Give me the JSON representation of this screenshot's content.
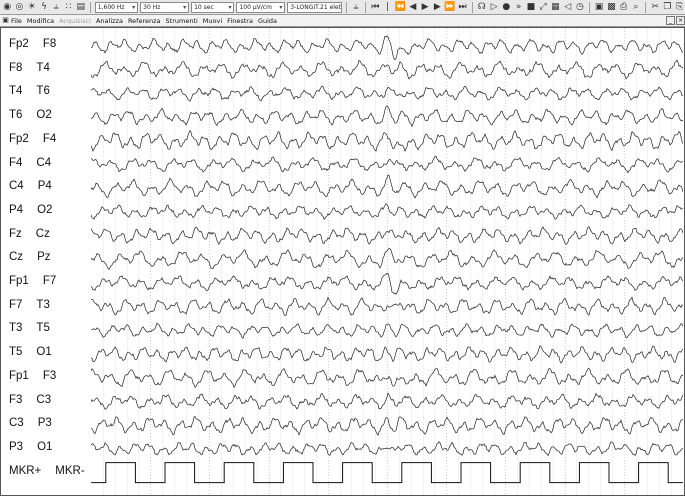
{
  "toolbar": {
    "left_icons": [
      "record-icon",
      "record-stop-icon",
      "photic-icon",
      "lightning-icon",
      "montage-icon",
      "chart-icon",
      "print-small-icon"
    ],
    "lowpass_value": "1,600 Hz",
    "highpass_value": "30 Hz",
    "timebase_value": "10 sec",
    "sensitivity_value": "100 µV/cm",
    "montage_value": "3-LONGIT.21 elettro",
    "transport_icons": [
      "first-icon",
      "prev-page-icon",
      "rewind-icon",
      "step-back-icon",
      "play-icon",
      "step-forward-icon",
      "fast-forward-icon",
      "last-icon"
    ],
    "right_icons": [
      "headphones-icon",
      "play-small-icon",
      "record-dot-icon",
      "fast-forward-small-icon",
      "stop-square-icon",
      "expand-icon",
      "grid-icon",
      "back-icon",
      "clock-icon",
      "open-folder-icon",
      "save-icon",
      "print-icon",
      "search-icon",
      "cut-icon",
      "copy-icon",
      "paste-icon"
    ]
  },
  "menu": {
    "items": [
      {
        "label": "File",
        "disabled": false
      },
      {
        "label": "Modifica",
        "disabled": false
      },
      {
        "label": "Acquisisci",
        "disabled": true
      },
      {
        "label": "Analizza",
        "disabled": false
      },
      {
        "label": "Referenza",
        "disabled": false
      },
      {
        "label": "Strumenti",
        "disabled": false
      },
      {
        "label": "Muovi",
        "disabled": false
      },
      {
        "label": "Finestra",
        "disabled": false
      },
      {
        "label": "Guida",
        "disabled": false
      }
    ],
    "window_buttons": [
      "_",
      "×"
    ]
  },
  "channels": [
    {
      "a": "Fp2",
      "b": "F8"
    },
    {
      "a": "F8",
      "b": "T4"
    },
    {
      "a": "T4",
      "b": "T6"
    },
    {
      "a": "T6",
      "b": "O2"
    },
    {
      "a": "Fp2",
      "b": "F4"
    },
    {
      "a": "F4",
      "b": "C4"
    },
    {
      "a": "C4",
      "b": "P4"
    },
    {
      "a": "P4",
      "b": "O2"
    },
    {
      "a": "Fz",
      "b": "Cz"
    },
    {
      "a": "Cz",
      "b": "Pz"
    },
    {
      "a": "Fp1",
      "b": "F7"
    },
    {
      "a": "F7",
      "b": "T3"
    },
    {
      "a": "T3",
      "b": "T5"
    },
    {
      "a": "T5",
      "b": "O1"
    },
    {
      "a": "Fp1",
      "b": "F3"
    },
    {
      "a": "F3",
      "b": "C3"
    },
    {
      "a": "C3",
      "b": "P3"
    },
    {
      "a": "P3",
      "b": "O1"
    }
  ],
  "marker_channel": {
    "a": "MKR+",
    "b": "MKR-"
  },
  "display": {
    "seconds_per_page": 10,
    "trace_color": "#222222",
    "grid_color": "#c8c8c8",
    "marker_color": "#111111"
  }
}
